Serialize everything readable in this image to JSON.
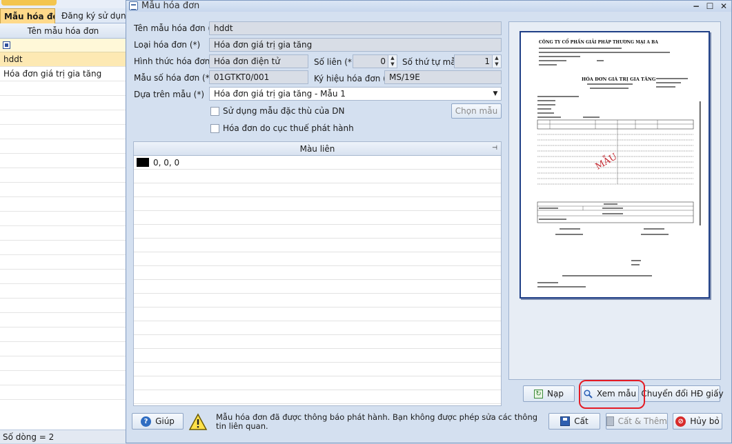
{
  "background": {
    "tab_active": "Mẫu hóa đơn",
    "tab_other": "Đăng ký sử dụng h",
    "grid_header": "Tên mẫu hóa đơn",
    "rows": [
      "hddt",
      "Hóa đơn giá trị gia tăng"
    ],
    "status": "Số dòng = 2"
  },
  "dialog": {
    "title": "Mẫu hóa đơn",
    "form": {
      "ten_mau_label": "Tên mẫu hóa đơn (*)",
      "ten_mau_value": "hddt",
      "loai_label": "Loại hóa đơn (*)",
      "loai_value": "Hóa đơn giá trị gia tăng",
      "hinh_thuc_label": "Hình thức hóa đơn (*)",
      "hinh_thuc_value": "Hóa đơn điện tử",
      "so_lien_label": "Số liên (*)",
      "so_lien_value": "0",
      "so_thu_tu_label": "Số thứ tự mẫu",
      "so_thu_tu_value": "1",
      "mau_so_label": "Mẫu số hóa đơn (*)",
      "mau_so_value": "01GTKT0/001",
      "ky_hieu_label": "Ký hiệu hóa đơn (*)",
      "ky_hieu_value": "MS/19E",
      "dua_tren_label": "Dựa trên mẫu (*)",
      "dua_tren_value": "Hóa đơn giá trị gia tăng - Mẫu 1",
      "su_dung_label": "Sử dụng mẫu đặc thù của DN",
      "chon_mau_label": "Chọn mẫu",
      "cuc_thue_label": "Hóa đơn do cục thuế phát hành"
    },
    "grid": {
      "header": "Màu liên",
      "rows": [
        "0, 0, 0"
      ]
    },
    "preview": {
      "company": "CÔNG TY CỔ PHẦN GIẢI PHÁP THƯƠNG MẠI A BA",
      "invoice_title": "HÓA ĐƠN GIÁ TRỊ GIA TĂNG",
      "watermark": "MẪU"
    },
    "buttons": {
      "nap": "Nạp",
      "xem_mau": "Xem mẫu",
      "chuyen_doi": "Chuyển đổi HĐ giấy",
      "giup": "Giúp",
      "cat": "Cất",
      "cat_them": "Cất & Thêm",
      "huy_bo": "Hủy bỏ"
    },
    "warning": "Mẫu hóa đơn đã được thông báo phát hành. Bạn không được phép sửa các thông tin liên quan."
  },
  "colors": {
    "highlight": "#e51b24",
    "accent": "#1e3e86"
  }
}
